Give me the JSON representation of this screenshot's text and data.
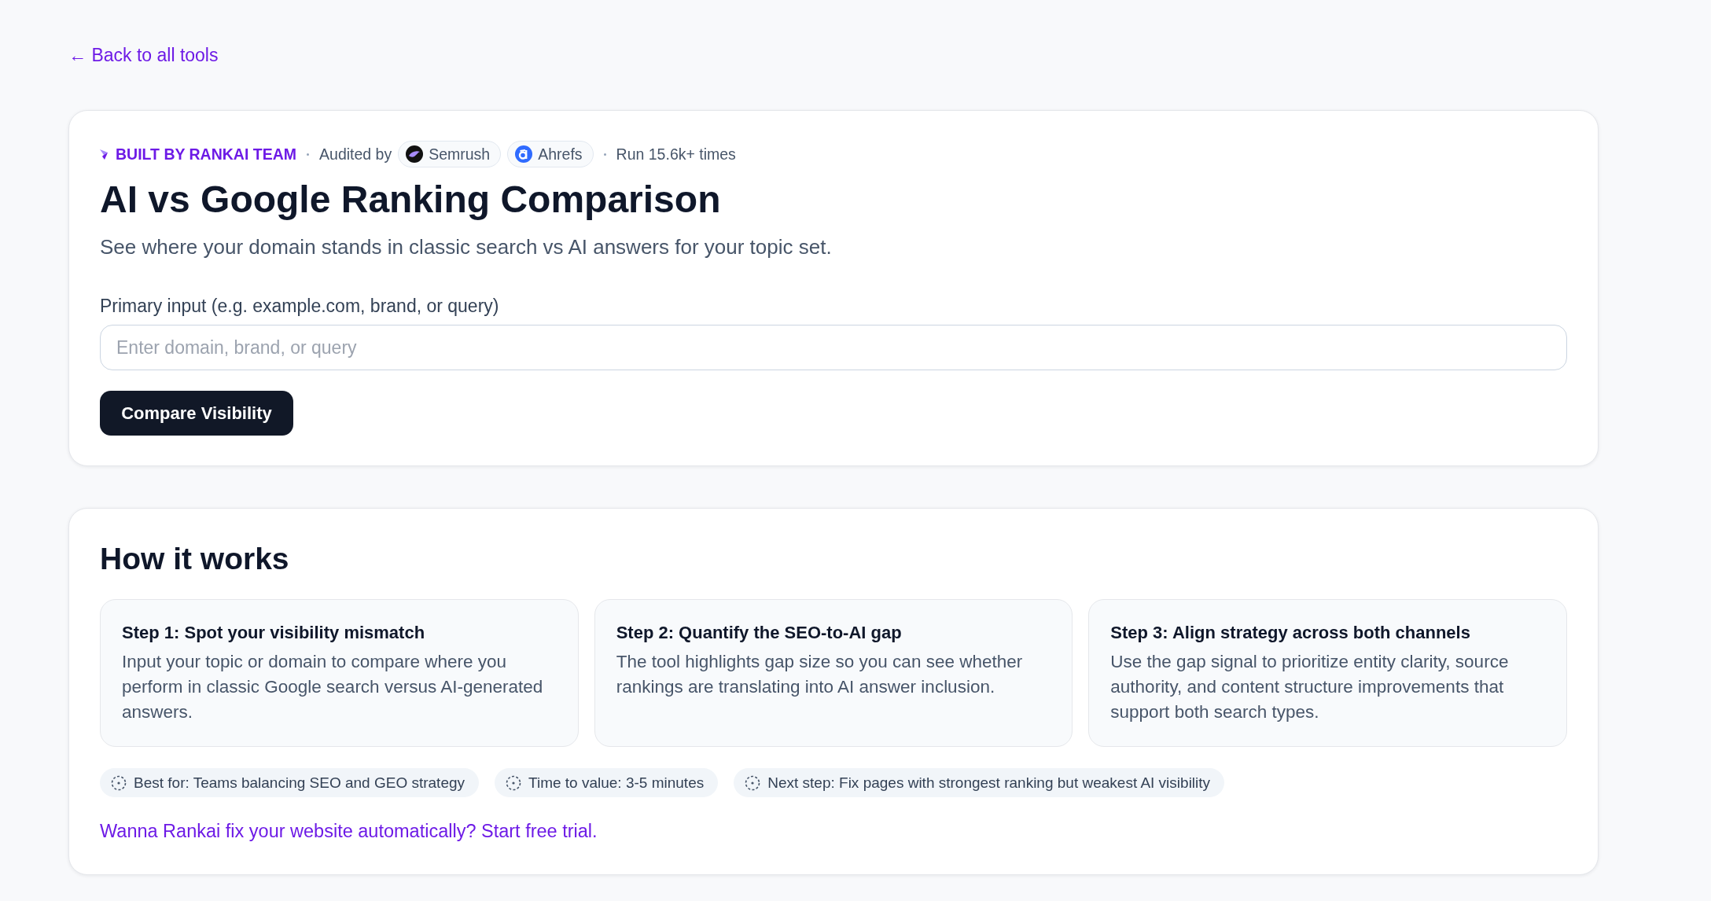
{
  "back_link": "← Back to all tools",
  "tool_card": {
    "meta": {
      "badge": "BUILT BY RANKAI TEAM",
      "audited_by": "Audited by",
      "auditors": [
        {
          "name": "Semrush",
          "kind": "swoosh"
        },
        {
          "name": "Ahrefs",
          "kind": "ring"
        }
      ],
      "runs": "Run 15.6k+ times"
    },
    "title": "AI vs Google Ranking Comparison",
    "description": "See where your domain stands in classic search vs AI answers for your topic set.",
    "input": {
      "label": "Primary input (e.g. example.com, brand, or query)",
      "placeholder": "Enter domain, brand, or query"
    },
    "button": "Compare Visibility"
  },
  "how_it_works": {
    "heading": "How it works",
    "steps": [
      {
        "title": "Step 1: Spot your visibility mismatch",
        "body": "Input your topic or domain to compare where you perform in classic Google search versus AI-generated answers."
      },
      {
        "title": "Step 2: Quantify the SEO-to-AI gap",
        "body": "The tool highlights gap size so you can see whether rankings are translating into AI answer inclusion."
      },
      {
        "title": "Step 3: Align strategy across both channels",
        "body": "Use the gap signal to prioritize entity clarity, source authority, and content structure improvements that support both search types."
      }
    ],
    "chips": [
      "Best for: Teams balancing SEO and GEO strategy",
      "Time to value: 3-5 minutes",
      "Next step: Fix pages with strongest ranking but weakest AI visibility"
    ],
    "cta": "Wanna Rankai fix your website automatically? Start free trial."
  }
}
